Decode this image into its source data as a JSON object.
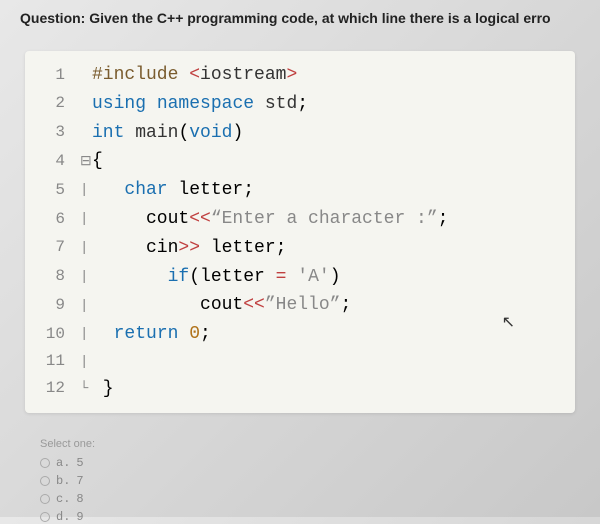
{
  "question": "Question: Given the C++ programming code, at which line there is a logical erro",
  "code": {
    "lines": [
      {
        "num": "1",
        "gutter": "",
        "html": "<span class='kw-preproc'>#include</span> <span class='kw-op'>&lt;</span><span class='kw-stream'>iostream</span><span class='kw-op'>&gt;</span>"
      },
      {
        "num": "2",
        "gutter": "",
        "html": "<span class='kw-blue'>using</span> <span class='kw-blue'>namespace</span> <span class='kw-namespace'>std</span>;"
      },
      {
        "num": "3",
        "gutter": "",
        "html": "<span class='kw-blue'>int</span> <span class='kw-func'>main</span>(<span class='kw-blue'>void</span>)"
      },
      {
        "num": "4",
        "gutter": "⊟",
        "html": "{"
      },
      {
        "num": "5",
        "gutter": "|",
        "html": "   <span class='kw-blue'>char</span> letter;"
      },
      {
        "num": "6",
        "gutter": "|",
        "html": "     cout<span class='kw-op'>&lt;&lt;</span><span class='kw-str'>“Enter a character :”</span>;"
      },
      {
        "num": "7",
        "gutter": "|",
        "html": "     cin<span class='kw-op'>&gt;&gt;</span> letter;"
      },
      {
        "num": "8",
        "gutter": "|",
        "html": "       <span class='kw-blue'>if</span>(letter <span class='kw-op'>=</span> <span class='kw-char'>'A'</span>)"
      },
      {
        "num": "9",
        "gutter": "|",
        "html": "          cout<span class='kw-op'>&lt;&lt;</span><span class='kw-str'>”Hello”</span>;"
      },
      {
        "num": "10",
        "gutter": "|",
        "html": "  <span class='kw-blue'>return</span> <span class='kw-num'>0</span>;"
      },
      {
        "num": "11",
        "gutter": "|",
        "html": ""
      },
      {
        "num": "12",
        "gutter": "└",
        "html": " }"
      }
    ]
  },
  "options": {
    "title": "Select one:",
    "items": [
      {
        "letter": "a.",
        "value": "5"
      },
      {
        "letter": "b.",
        "value": "7"
      },
      {
        "letter": "c.",
        "value": "8"
      },
      {
        "letter": "d.",
        "value": "9"
      }
    ]
  },
  "cursor": "⇱"
}
